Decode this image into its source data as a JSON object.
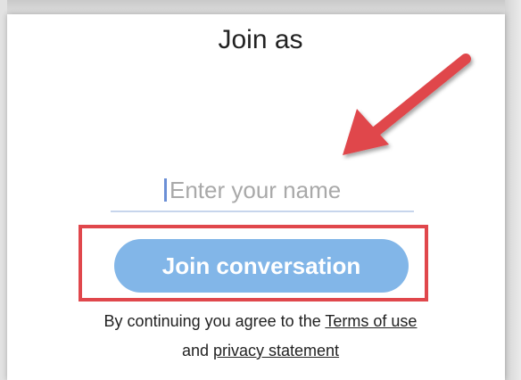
{
  "dialog": {
    "title": "Join as"
  },
  "name_field": {
    "placeholder": "Enter your name",
    "value": ""
  },
  "join_button": {
    "label": "Join conversation"
  },
  "legal": {
    "prefix": "By continuing you agree to the",
    "terms_link": "Terms of use",
    "connector": "and",
    "privacy_link": "privacy statement"
  },
  "annotations": {
    "arrow_color": "#e0474c",
    "highlight_color": "#e0474c"
  },
  "colors": {
    "button_bg": "#82b6e8",
    "field_underline": "#c7d5ec",
    "caret": "#6b8fd6"
  },
  "icons": {
    "pointer": "arrow-icon"
  }
}
